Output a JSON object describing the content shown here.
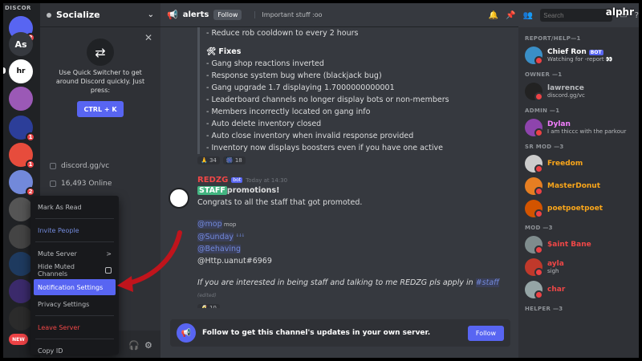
{
  "rail": {
    "title": "DISCOR",
    "servers": [
      {
        "label": "",
        "badge": "2",
        "color": "#5865f2"
      },
      {
        "label": "As",
        "badge": "",
        "color": "#36393f"
      },
      {
        "label": "",
        "badge": "",
        "color": "#fff"
      },
      {
        "label": "",
        "badge": "",
        "color": "#9b59b6"
      },
      {
        "label": "",
        "badge": "1",
        "color": "#3498db"
      },
      {
        "label": "",
        "badge": "1",
        "color": "#e74c3c"
      },
      {
        "label": "",
        "badge": "2",
        "color": "#7289da"
      }
    ]
  },
  "sidebar": {
    "server_name": "Socialize",
    "quick_switcher": {
      "text": "Use Quick Switcher to get around Discord quickly. Just press:",
      "shortcut": "CTRL + K"
    },
    "invite": "discord.gg/vc",
    "online": "16,493 Online"
  },
  "context_menu": {
    "items": [
      {
        "label": "Mark As Read",
        "style": ""
      },
      {
        "label": "Invite People",
        "style": "blue"
      },
      {
        "label": "Mute Server",
        "style": "",
        "right": ">"
      },
      {
        "label": "Hide Muted Channels",
        "style": "",
        "checkbox": true
      },
      {
        "label": "Notification Settings",
        "style": "active"
      },
      {
        "label": "Privacy Settings",
        "style": ""
      },
      {
        "label": "Leave Server",
        "style": "red"
      },
      {
        "label": "Copy ID",
        "style": ""
      }
    ]
  },
  "main": {
    "channel": "alerts",
    "follow_label": "Follow",
    "topic": "Important stuff :oo",
    "message1": {
      "top_line": "- Reduce rob cooldown to every 2 hours",
      "fixes_title": "Fixes",
      "fixes": [
        "- Gang shop reactions inverted",
        "- Response system bug where (blackjack bug)",
        "- Gang upgrade 1.7 displaying 1.7000000000001",
        "- Leaderboard channels no longer display bots or non-members",
        "- Members incorrectly located on gang info",
        "- Auto delete inventory closed",
        "- Auto close inventory when invalid response provided",
        "- Inventory now displays boosters even if you have one active"
      ],
      "reactions": [
        "34",
        "18"
      ]
    },
    "message2": {
      "author": "REDZG",
      "tag": "bot",
      "time": "Today at 14:30",
      "staff_label": "STAFF",
      "line1_rest": "promotions!",
      "line2": "Congrats to all the staff that got promoted.",
      "mentions": [
        "@mop",
        "@Sunday",
        "@Behaving"
      ],
      "mention_suffixes": [
        " mop",
        " ꜜꜜꜜ",
        ""
      ],
      "http_line": "@Http.uanut#6969",
      "italic_prefix": "If you are interested in being staff and talking to me REDZG pls apply in ",
      "channel_link": "#staff",
      "edited": "(edited)",
      "reaction": "10"
    },
    "follow_banner": {
      "text": "Follow to get this channel's updates in your own server.",
      "button": "Follow"
    }
  },
  "topright": {
    "search_placeholder": "Search"
  },
  "members": {
    "groups": [
      {
        "title": "REPORT/HELP—1",
        "members": [
          {
            "name": "Chief Ron",
            "bot": "BOT",
            "status": "Watching for -report 👀",
            "color": "#ffffff"
          }
        ]
      },
      {
        "title": "OWNER —1",
        "members": [
          {
            "name": "lawrence",
            "bot": "",
            "status": "discord.gg/vc",
            "color": "#b9bbbe"
          }
        ]
      },
      {
        "title": "ADMIN —1",
        "members": [
          {
            "name": "Dylan",
            "bot": "",
            "status": "I am thiccc with the parkour",
            "color": "#f47fff"
          }
        ]
      },
      {
        "title": "SR MOD —3",
        "members": [
          {
            "name": "Freedom",
            "bot": "",
            "status": "",
            "color": "#faa61a"
          },
          {
            "name": "MasterDonut",
            "bot": "",
            "status": "",
            "color": "#faa61a"
          },
          {
            "name": "poetpoetpoet",
            "bot": "",
            "status": "",
            "color": "#faa61a"
          }
        ]
      },
      {
        "title": "MOD —3",
        "members": [
          {
            "name": "$aint Bane",
            "bot": "",
            "status": "",
            "color": "#f04747"
          },
          {
            "name": "ayla",
            "bot": "",
            "status": "sigh",
            "color": "#f04747"
          },
          {
            "name": "char",
            "bot": "",
            "status": "",
            "color": "#f04747"
          }
        ]
      },
      {
        "title": "HELPER —3",
        "members": []
      }
    ]
  },
  "watermark": "alphr",
  "colors": {
    "accent": "#5865f2",
    "danger": "#f04747",
    "staff": "#43b581"
  }
}
